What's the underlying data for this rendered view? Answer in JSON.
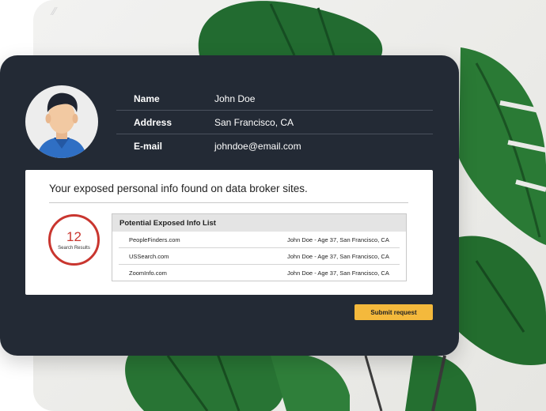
{
  "profile": {
    "avatar_icon": "person-avatar-icon",
    "fields": [
      {
        "label": "Name",
        "value": "John Doe"
      },
      {
        "label": "Address",
        "value": "San Francisco, CA"
      },
      {
        "label": "E-mail",
        "value": "johndoe@email.com"
      }
    ]
  },
  "panel": {
    "title": "Your exposed personal info found on data broker sites.",
    "counter": {
      "value": "12",
      "label": "Search Results"
    },
    "list": {
      "header": "Potential Exposed Info List",
      "rows": [
        {
          "site": "PeopleFinders.com",
          "detail": "John Doe - Age 37, San Francisco, CA"
        },
        {
          "site": "USSearch.com",
          "detail": "John Doe - Age 37, San Francisco, CA"
        },
        {
          "site": "ZoomInfo.com",
          "detail": "John Doe - Age 37, San Francisco, CA"
        }
      ]
    }
  },
  "actions": {
    "submit_label": "Submit request"
  },
  "colors": {
    "card_bg": "#232a35",
    "accent_red": "#c9362f",
    "button_yellow": "#f4b93c",
    "leaf_green": "#1f6b2e"
  }
}
